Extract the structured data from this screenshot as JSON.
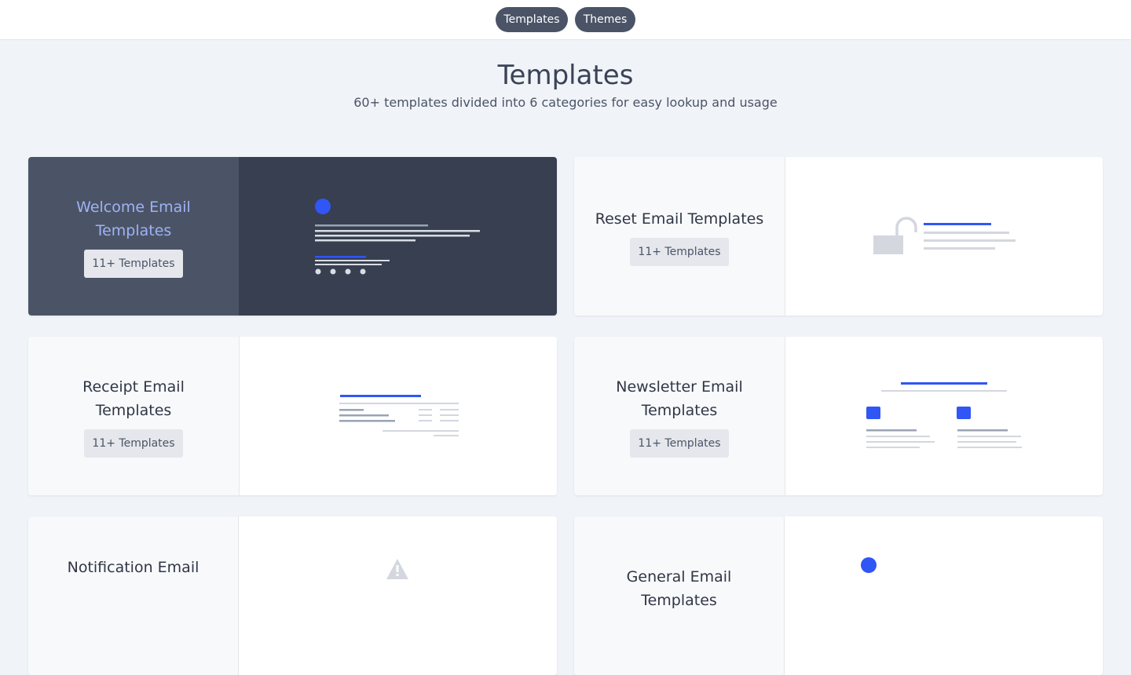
{
  "nav": {
    "tab_templates": "Templates",
    "tab_themes": "Themes"
  },
  "hero": {
    "title": "Templates",
    "subtitle": "60+ templates divided into 6 categories for easy lookup and usage"
  },
  "colors": {
    "accent": "#3056f5",
    "dark_panel": "#373f50",
    "dark_left": "#4b5466",
    "highlight_text": "#9fb2f5"
  },
  "cards": [
    {
      "name": "Welcome Email Templates",
      "count": "11+ Templates",
      "icon": "welcome-illustration-icon",
      "active": true
    },
    {
      "name": "Reset Email Templates",
      "count": "11+ Templates",
      "icon": "unlock-illustration-icon",
      "active": false
    },
    {
      "name": "Receipt Email Templates",
      "count": "11+ Templates",
      "icon": "receipt-illustration-icon",
      "active": false
    },
    {
      "name": "Newsletter Email Templates",
      "count": "11+ Templates",
      "icon": "newsletter-illustration-icon",
      "active": false
    },
    {
      "name": "Notification Email",
      "count": "",
      "icon": "warning-illustration-icon",
      "active": false
    },
    {
      "name": "General Email Templates",
      "count": "",
      "icon": "general-illustration-icon",
      "active": false
    }
  ]
}
